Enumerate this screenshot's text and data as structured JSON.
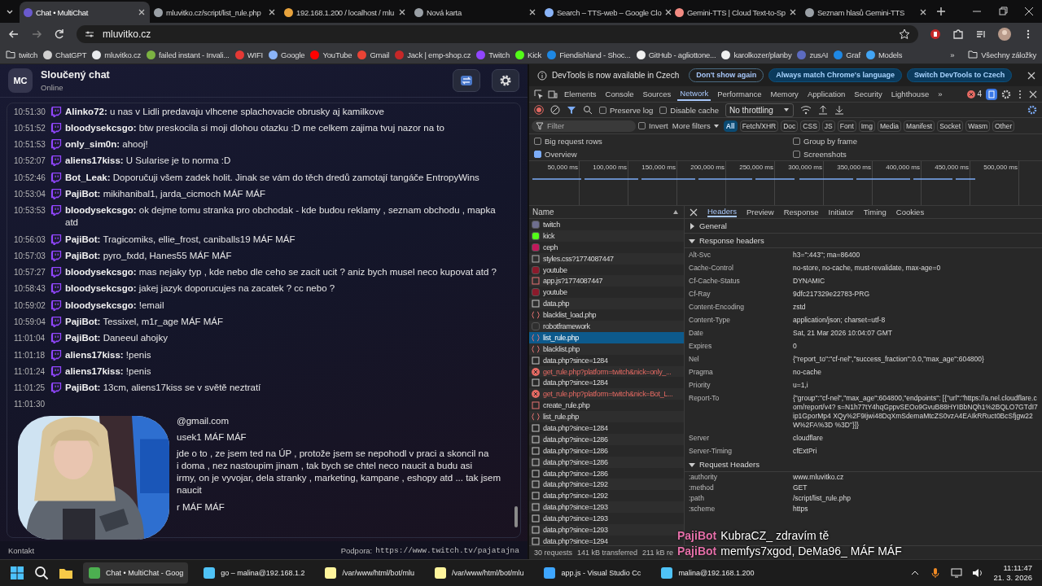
{
  "browser": {
    "tabs": [
      {
        "title": "Chat • MultiChat",
        "selected": true,
        "color": "#6a5acd"
      },
      {
        "title": "mluvitko.cz/script/list_rule.php",
        "selected": false,
        "color": "#9aa0a6"
      },
      {
        "title": "192.168.1.200 / localhost / mlu",
        "selected": false,
        "color": "#e8a33d"
      },
      {
        "title": "Nová karta",
        "selected": false,
        "color": "#9aa0a6"
      },
      {
        "title": "Search – TTS-web – Google Clo",
        "selected": false,
        "color": "#8ab4f8"
      },
      {
        "title": "Gemini-TTS | Cloud Text-to-Sp",
        "selected": false,
        "color": "#f28b82"
      },
      {
        "title": "Seznam hlasů Gemini-TTS",
        "selected": false,
        "color": "#9aa0a6"
      }
    ],
    "address": "mluvitko.cz",
    "bookmarks": [
      {
        "label": "twitch",
        "kind": "folder"
      },
      {
        "label": "ChatGPT",
        "kind": "site",
        "color": "#d0d0d0"
      },
      {
        "label": "mluvitko.cz",
        "kind": "site",
        "color": "#e8eaed"
      },
      {
        "label": "failed instant - Invali...",
        "kind": "site",
        "color": "#7cb342"
      },
      {
        "label": "WIFI",
        "kind": "site",
        "color": "#e53935"
      },
      {
        "label": "Google",
        "kind": "site",
        "color": "#8ab4f8"
      },
      {
        "label": "YouTube",
        "kind": "site",
        "color": "#ff0000"
      },
      {
        "label": "Gmail",
        "kind": "site",
        "color": "#ea4335"
      },
      {
        "label": "Jack | emp-shop.cz",
        "kind": "site",
        "color": "#c62828"
      },
      {
        "label": "Twitch",
        "kind": "site",
        "color": "#9146ff"
      },
      {
        "label": "Kick",
        "kind": "site",
        "color": "#53fc18"
      },
      {
        "label": "Fiendishland - Shoc...",
        "kind": "site",
        "color": "#1e88e5"
      },
      {
        "label": "GitHub - agliottone...",
        "kind": "site",
        "color": "#f0f0f0"
      },
      {
        "label": "karolkozer/planby",
        "kind": "site",
        "color": "#f0f0f0"
      },
      {
        "label": "zusAI",
        "kind": "site",
        "color": "#5c6bc0"
      },
      {
        "label": "Graf",
        "kind": "site",
        "color": "#1e88e5"
      },
      {
        "label": "Models",
        "kind": "site",
        "color": "#42a5f5"
      }
    ],
    "more": "»",
    "all_bookmarks": "Všechny záložky"
  },
  "chat": {
    "avatar": "MC",
    "title": "Sloučený chat",
    "status": "Online",
    "messages": [
      {
        "kind": "message",
        "time": "10:51:30",
        "user": "Alinko72:",
        "text": "u nas v Lidli predavaju vlhcene splachovacie obrusky aj kamilkove"
      },
      {
        "kind": "message",
        "time": "10:51:52",
        "user": "bloodysekcsgo:",
        "text": "btw preskocila si moji dlohou otazku :D me celkem zajima tvuj nazor na to"
      },
      {
        "kind": "message",
        "time": "10:51:53",
        "user": "only_sim0n:",
        "text": "ahooj!"
      },
      {
        "kind": "message",
        "time": "10:52:07",
        "user": "aliens17kiss:",
        "text": "U Sularise je to norma :D"
      },
      {
        "kind": "message",
        "time": "10:52:46",
        "user": "Bot_Leak:",
        "text": "Doporučuji všem zadek holit. Jinak se vám do těch dredů zamotají tangáče EntropyWins"
      },
      {
        "kind": "message",
        "time": "10:53:04",
        "user": "PajiBot:",
        "text": "mikihanibal1, jarda_cicmoch MÁF MÁF"
      },
      {
        "kind": "message",
        "time": "10:53:53",
        "user": "bloodysekcsgo:",
        "text": "ok dejme tomu stranka pro obchodak - kde budou reklamy , seznam obchodu , mapka atd"
      },
      {
        "kind": "message",
        "time": "10:56:03",
        "user": "PajiBot:",
        "text": "Tragicomiks, ellie_frost, caniballs19 MÁF MÁF"
      },
      {
        "kind": "message",
        "time": "10:57:03",
        "user": "PajiBot:",
        "text": "pyro_fxdd, Hanes55 MÁF MÁF"
      },
      {
        "kind": "message",
        "time": "10:57:27",
        "user": "bloodysekcsgo:",
        "text": "mas nejaky typ , kde nebo dle ceho se zacit ucit ? aniz bych musel neco kupovat atd ?"
      },
      {
        "kind": "message",
        "time": "10:58:43",
        "user": "bloodysekcsgo:",
        "text": "jakej jazyk doporucujes na zacatek ? cc nebo ?"
      },
      {
        "kind": "message",
        "time": "10:59:02",
        "user": "bloodysekcsgo:",
        "text": "!email"
      },
      {
        "kind": "message",
        "time": "10:59:04",
        "user": "PajiBot:",
        "text": "Tessixel, m1r_age MÁF MÁF"
      },
      {
        "kind": "message",
        "time": "11:01:04",
        "user": "PajiBot:",
        "text": "Daneeul ahojky"
      },
      {
        "kind": "message",
        "time": "11:01:18",
        "user": "aliens17kiss:",
        "text": "!penis"
      },
      {
        "kind": "message",
        "time": "11:01:24",
        "user": "aliens17kiss:",
        "text": "!penis"
      },
      {
        "kind": "message",
        "time": "11:01:25",
        "user": "PajiBot:",
        "text": "13cm, aliens17kiss se v světě neztratí"
      },
      {
        "kind": "partial",
        "time": "11:01:30"
      },
      {
        "kind": "partial",
        "lines": [
          "@gmail.com"
        ]
      },
      {
        "kind": "partial",
        "lines": [
          "usek1 MÁF MÁF"
        ]
      },
      {
        "kind": "partial",
        "lines": [
          "jde o to , ze jsem ted na ÚP , protože jsem se nepohodl v praci a skoncil na",
          "i doma , nez nastoupim jinam , tak bych se chtel neco naucit a budu asi",
          "irmy, on je vyvojar, dela stranky , marketing, kampane , eshopy atd ... tak jsem",
          "naucit"
        ]
      },
      {
        "kind": "partial",
        "lines": [
          "r MÁF MÁF"
        ]
      }
    ],
    "contact": "Kontakt",
    "support_label": "Podpora:",
    "support_url": "https://www.twitch.tv/pajatajna"
  },
  "devtools": {
    "infobar": {
      "text": "DevTools is now available in Czech",
      "buttons": [
        "Don't show again",
        "Always match Chrome's language",
        "Switch DevTools to Czech"
      ]
    },
    "panels": [
      {
        "label": "Elements",
        "selected": false
      },
      {
        "label": "Console",
        "selected": false
      },
      {
        "label": "Sources",
        "selected": false
      },
      {
        "label": "Network",
        "selected": true
      },
      {
        "label": "Performance",
        "selected": false
      },
      {
        "label": "Memory",
        "selected": false
      },
      {
        "label": "Application",
        "selected": false
      },
      {
        "label": "Security",
        "selected": false
      },
      {
        "label": "Lighthouse",
        "selected": false
      }
    ],
    "more": "»",
    "errors": "4",
    "preserve_log": {
      "label": "Preserve log",
      "checked": false
    },
    "disable_cache": {
      "label": "Disable cache",
      "checked": false
    },
    "throttling": "No throttling",
    "filter_placeholder": "Filter",
    "invert": {
      "label": "Invert",
      "checked": false
    },
    "more_filters": "More filters",
    "types": [
      {
        "label": "All",
        "selected": true
      },
      {
        "label": "Fetch/XHR",
        "selected": false
      },
      {
        "label": "Doc",
        "selected": false
      },
      {
        "label": "CSS",
        "selected": false
      },
      {
        "label": "JS",
        "selected": false
      },
      {
        "label": "Font",
        "selected": false
      },
      {
        "label": "Img",
        "selected": false
      },
      {
        "label": "Media",
        "selected": false
      },
      {
        "label": "Manifest",
        "selected": false
      },
      {
        "label": "Socket",
        "selected": false
      },
      {
        "label": "Wasm",
        "selected": false
      },
      {
        "label": "Other",
        "selected": false
      }
    ],
    "options": [
      {
        "label": "Big request rows",
        "checked": false
      },
      {
        "label": "Group by frame",
        "checked": false
      },
      {
        "label": "Overview",
        "checked": true
      },
      {
        "label": "Screenshots",
        "checked": false
      }
    ],
    "overview_ticks": [
      "50,000 ms",
      "100,000 ms",
      "150,000 ms",
      "200,000 ms",
      "250,000 ms",
      "300,000 ms",
      "350,000 ms",
      "400,000 ms",
      "450,000 ms",
      "500,000 ms"
    ],
    "name_column": "Name",
    "requests": [
      {
        "name": "twitch",
        "kind": "favicon",
        "color": "#6e6e8e",
        "selected": false
      },
      {
        "name": "kick",
        "kind": "favicon",
        "color": "#53fc18",
        "selected": false
      },
      {
        "name": "ceph",
        "kind": "favicon",
        "color": "#c2185b",
        "selected": false
      },
      {
        "name": "styles.css?1774087447",
        "kind": "css",
        "selected": false
      },
      {
        "name": "youtube",
        "kind": "favicon",
        "color": "#8b1a2b",
        "selected": false
      },
      {
        "name": "app.js?1774087447",
        "kind": "script",
        "selected": false
      },
      {
        "name": "youtube",
        "kind": "favicon",
        "color": "#8b1a2b",
        "selected": false
      },
      {
        "name": "data.php",
        "kind": "doc",
        "selected": false
      },
      {
        "name": "blacklist_load.php",
        "kind": "fetch",
        "selected": false
      },
      {
        "name": "robotframework",
        "kind": "favicon",
        "color": "#2f2f2f",
        "selected": false
      },
      {
        "name": "list_rule.php",
        "kind": "fetch",
        "selected": true
      },
      {
        "name": "blacklist.php",
        "kind": "fetch",
        "selected": false
      },
      {
        "name": "data.php?since=1284",
        "kind": "doc",
        "selected": false
      },
      {
        "name": "get_rule.php?platform=twitch&nick=only_...",
        "kind": "error",
        "selected": false
      },
      {
        "name": "data.php?since=1284",
        "kind": "doc",
        "selected": false
      },
      {
        "name": "get_rule.php?platform=twitch&nick=Bot_L...",
        "kind": "error",
        "selected": false
      },
      {
        "name": "create_rule.php",
        "kind": "script",
        "selected": false
      },
      {
        "name": "list_rule.php",
        "kind": "fetch",
        "selected": false
      },
      {
        "name": "data.php?since=1284",
        "kind": "doc",
        "selected": false
      },
      {
        "name": "data.php?since=1286",
        "kind": "doc",
        "selected": false
      },
      {
        "name": "data.php?since=1286",
        "kind": "doc",
        "selected": false
      },
      {
        "name": "data.php?since=1286",
        "kind": "doc",
        "selected": false
      },
      {
        "name": "data.php?since=1286",
        "kind": "doc",
        "selected": false
      },
      {
        "name": "data.php?since=1292",
        "kind": "doc",
        "selected": false
      },
      {
        "name": "data.php?since=1292",
        "kind": "doc",
        "selected": false
      },
      {
        "name": "data.php?since=1293",
        "kind": "doc",
        "selected": false
      },
      {
        "name": "data.php?since=1293",
        "kind": "doc",
        "selected": false
      },
      {
        "name": "data.php?since=1293",
        "kind": "doc",
        "selected": false
      },
      {
        "name": "data.php?since=1294",
        "kind": "doc",
        "selected": false
      }
    ],
    "detail_tabs": [
      {
        "label": "Headers",
        "selected": true
      },
      {
        "label": "Preview",
        "selected": false
      },
      {
        "label": "Response",
        "selected": false
      },
      {
        "label": "Initiator",
        "selected": false
      },
      {
        "label": "Timing",
        "selected": false
      },
      {
        "label": "Cookies",
        "selected": false
      }
    ],
    "sections": [
      {
        "title": "General",
        "expanded": false
      },
      {
        "title": "Response headers",
        "expanded": true,
        "headers": [
          {
            "name": "Alt-Svc",
            "value": "h3=\":443\"; ma=86400"
          },
          {
            "name": "Cache-Control",
            "value": "no-store, no-cache, must-revalidate, max-age=0"
          },
          {
            "name": "Cf-Cache-Status",
            "value": "DYNAMIC"
          },
          {
            "name": "Cf-Ray",
            "value": "9dfc217329e22783-PRG"
          },
          {
            "name": "Content-Encoding",
            "value": "zstd"
          },
          {
            "name": "Content-Type",
            "value": "application/json; charset=utf-8"
          },
          {
            "name": "Date",
            "value": "Sat, 21 Mar 2026 10:04:07 GMT"
          },
          {
            "name": "Expires",
            "value": "0"
          },
          {
            "name": "Nel",
            "value": "{\"report_to\":\"cf-nel\",\"success_fraction\":0.0,\"max_age\":604800}"
          },
          {
            "name": "Pragma",
            "value": "no-cache"
          },
          {
            "name": "Priority",
            "value": "u=1,i"
          },
          {
            "name": "Report-To",
            "value": "{\"group\":\"cf-nel\",\"max_age\":604800,\"endpoints\": [{\"url\":\"https://a.nel.cloudflare.com/report/v4? s=N1h77tY4hqGppvSEOo9GvuB88HYIBbNQh1%2BQLO7GTdI7ip1GporMp4 XQy%2F9Ijwi48DqXmSdemaMtcZS0vzA4EAIkRRuct0BcSfjgw22W%2FA%3D %3D\"}]}"
          },
          {
            "name": "Server",
            "value": "cloudflare"
          },
          {
            "name": "Server-Timing",
            "value": "cfExtPri"
          }
        ]
      },
      {
        "title": "Request Headers",
        "expanded": true,
        "headers": [
          {
            "name": ":authority",
            "value": "www.mluvitko.cz"
          },
          {
            "name": ":method",
            "value": "GET"
          },
          {
            "name": ":path",
            "value": "/script/list_rule.php"
          },
          {
            "name": ":scheme",
            "value": "https"
          }
        ]
      }
    ],
    "status": [
      "30 requests",
      "141 kB transferred",
      "211 kB re"
    ]
  },
  "stream_overlay": [
    {
      "user": "PajiBot",
      "text": "KubraCZ_ zdravím tě"
    },
    {
      "user": "PajiBot",
      "text": "memfys7xgod, DeMa96_ MÁF MÁF"
    }
  ],
  "taskbar": {
    "apps": [
      {
        "label": "Chat • MultiChat - Goog",
        "kind": "chrome",
        "selected": true
      },
      {
        "label": "go – malina@192.168.1.2",
        "kind": "terminal",
        "selected": false
      },
      {
        "label": "/var/www/html/bot/mlu",
        "kind": "editor",
        "selected": false
      },
      {
        "label": "/var/www/html/bot/mlu",
        "kind": "editor",
        "selected": false
      },
      {
        "label": "app.js - Visual Studio Cc",
        "kind": "vscode",
        "selected": false
      },
      {
        "label": "malina@192.168.1.200",
        "kind": "terminal",
        "selected": false
      }
    ],
    "time": "11:11:47",
    "date": "21. 3. 2026"
  }
}
